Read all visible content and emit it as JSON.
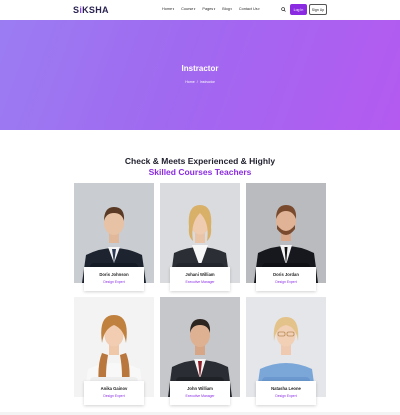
{
  "brand": {
    "logo_s": "S",
    "logo_i": "i",
    "logo_rest": "KSHA"
  },
  "nav": {
    "items": [
      {
        "label": "Home"
      },
      {
        "label": "Course"
      },
      {
        "label": "Pages"
      },
      {
        "label": "Blog"
      },
      {
        "label": "Contact Us"
      }
    ],
    "login_label": "Log In",
    "signup_label": "Sign Up"
  },
  "hero": {
    "title": "Instractor",
    "breadcrumb": [
      "Home",
      "/",
      "Instructor"
    ]
  },
  "section": {
    "heading_line1": "Check & Meets Experienced & Highly",
    "heading_line2": "Skilled Courses Teachers"
  },
  "teachers": [
    {
      "name": "Doris Johnson",
      "role": "Design Expert"
    },
    {
      "name": "Johani William",
      "role": "Executive Manager"
    },
    {
      "name": "Doris Jordan",
      "role": "Design Expert"
    },
    {
      "name": "Anika Gainov",
      "role": "Design Expert"
    },
    {
      "name": "John William",
      "role": "Executive Manager"
    },
    {
      "name": "Natasha Leone",
      "role": "Design Expert"
    }
  ],
  "colors": {
    "accent": "#8a2be2",
    "hero_start": "#9b7df2",
    "hero_end": "#b45af0"
  },
  "icons": {
    "search": "search-icon",
    "caret": "chevron-down-icon"
  }
}
